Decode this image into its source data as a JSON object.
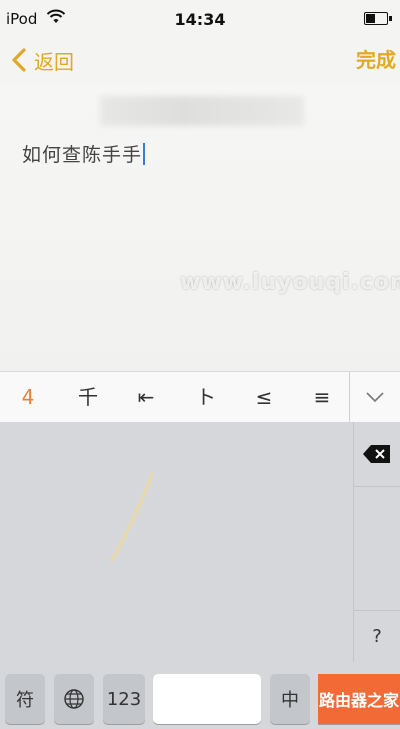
{
  "status_bar": {
    "carrier": "iPod",
    "time": "14:34"
  },
  "nav": {
    "back_label": "返回",
    "done_label": "完成"
  },
  "note": {
    "text": "如何查陈手手"
  },
  "candidates": [
    "4",
    "千",
    "⇤",
    "ト",
    "≤",
    "≡"
  ],
  "keyboard": {
    "symbol_key": "符",
    "numbers_key": "123",
    "space_label": "",
    "lang_key": "中",
    "question_key": "?",
    "enter_label": "路由器之家"
  },
  "watermark": "www.luyouqi.com",
  "colors": {
    "accent": "#e0a926",
    "enter": "#f26a35",
    "keyboard_bg": "#d5d7da"
  }
}
